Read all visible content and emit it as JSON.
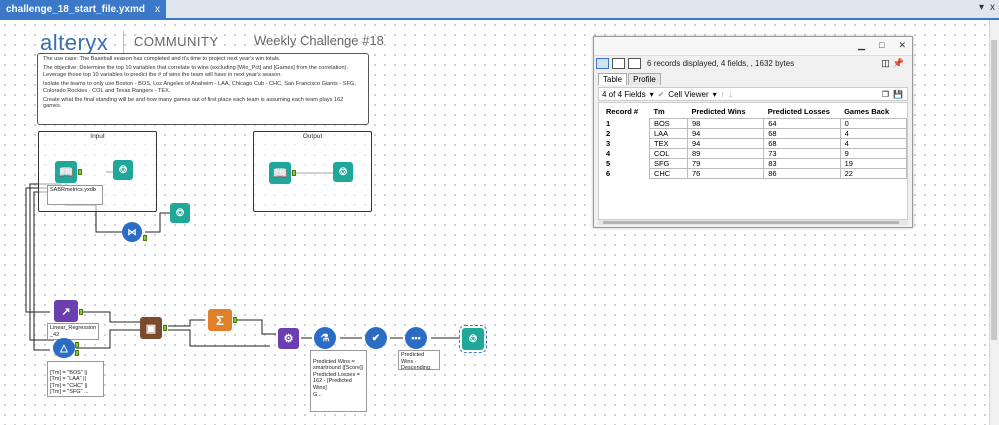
{
  "tab": {
    "title": "challenge_18_start_file.yxmd",
    "close": "x"
  },
  "window_controls": {
    "dropdown": "▾",
    "close": "x"
  },
  "header": {
    "brand": "alteryx",
    "community": "COMMUNITY",
    "challenge": "Weekly Challenge #18"
  },
  "description": {
    "p1": "The use case: The Baseball season has completed and it's time to project next year's win totals.",
    "p2": "The objective: Determine the top 10 variables that correlate to wins (excluding [Win_Pct] and [Games] from the correlation). Leverage those top 10 variables to predict the # of wins the team will have in next year's season.",
    "p3": "Isolate the teams to only use Boston - BOS, Los Angeles of Anaheim - LAA, Chicago Cub - CHC, San Francisco Giants - SFG, Colorado Rockies - COL and Texas Rangers - TEX.",
    "p4": "Create what the final standing will be and how many games out of first place each team is assuming each team plays 162 games."
  },
  "containers": {
    "input": "Input",
    "output": "Output"
  },
  "notes": {
    "sabr": "SABRmetrics.yxdb",
    "linreg": "Linear_Regression _42",
    "filter": "[Tm] = \"BOS\" ||\n[Tm] = \"LAA\" ||\n[Tm] = \"CHC\" ||\n[Tm] = \"SFG\" ...",
    "formula": "Predicted Wins = smartround ([Score])\nPredicted Losses = 162 - [Predicted Wins]\nG...",
    "sort": "Predicted Wins - Descending"
  },
  "results": {
    "window_buttons": {
      "minimize": "▁",
      "maximize": "□",
      "close": "✕"
    },
    "status": "6 records displayed, 4 fields, , 1632 bytes",
    "tabs": [
      "Table",
      "Profile"
    ],
    "fields_label": "4 of 4 Fields",
    "cell_viewer": "Cell Viewer",
    "columns": [
      "Record #",
      "Tm",
      "Predicted Wins",
      "Predicted Losses",
      "Games Back"
    ],
    "rows": [
      [
        "1",
        "BOS",
        "98",
        "64",
        "0"
      ],
      [
        "2",
        "LAA",
        "94",
        "68",
        "4"
      ],
      [
        "3",
        "TEX",
        "94",
        "68",
        "4"
      ],
      [
        "4",
        "COL",
        "89",
        "73",
        "9"
      ],
      [
        "5",
        "SFG",
        "79",
        "83",
        "19"
      ],
      [
        "6",
        "CHC",
        "76",
        "86",
        "22"
      ]
    ]
  },
  "colors": {
    "accent": "#3c78c8",
    "tool_teal": "#1fa89a",
    "tool_purple": "#6c3fb0",
    "tool_red": "#e04a3a",
    "tool_orange": "#e0802a",
    "tool_blue": "#2b6cc4",
    "anchor_green": "#8fc43f"
  },
  "icons": [
    "book-icon",
    "binoculars-icon",
    "join-icon",
    "regression-icon",
    "filter-icon",
    "score-icon",
    "summarize-icon",
    "append-icon",
    "formula-icon",
    "sort-icon",
    "dots-icon"
  ]
}
